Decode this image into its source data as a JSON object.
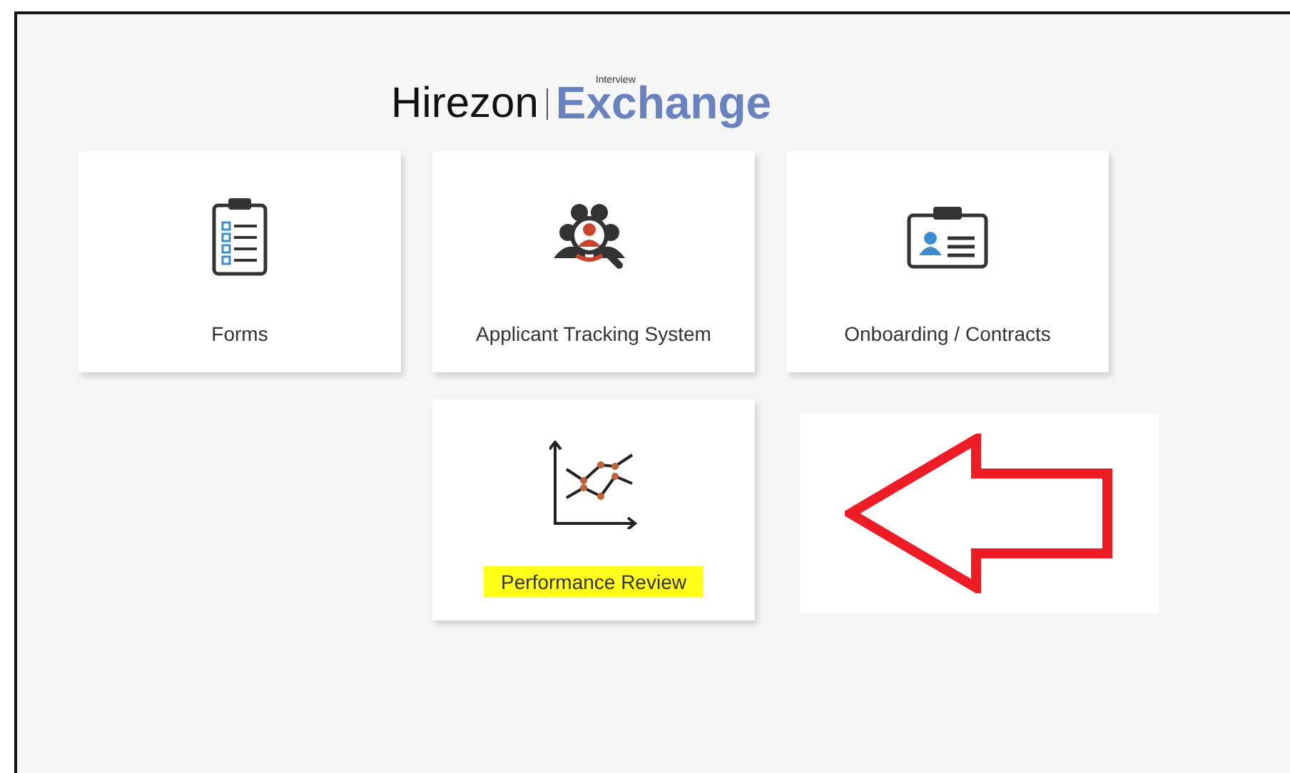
{
  "logo": {
    "brand": "Hirezon",
    "product_small": "Interview",
    "product": "Exchange"
  },
  "tiles": [
    {
      "kind": "forms",
      "label": "Forms",
      "highlighted": false
    },
    {
      "kind": "tracking",
      "label": "Applicant Tracking System",
      "highlighted": false
    },
    {
      "kind": "onboarding",
      "label": "Onboarding / Contracts",
      "highlighted": false
    },
    {
      "kind": "chart",
      "label": "Performance Review",
      "highlighted": true
    }
  ]
}
